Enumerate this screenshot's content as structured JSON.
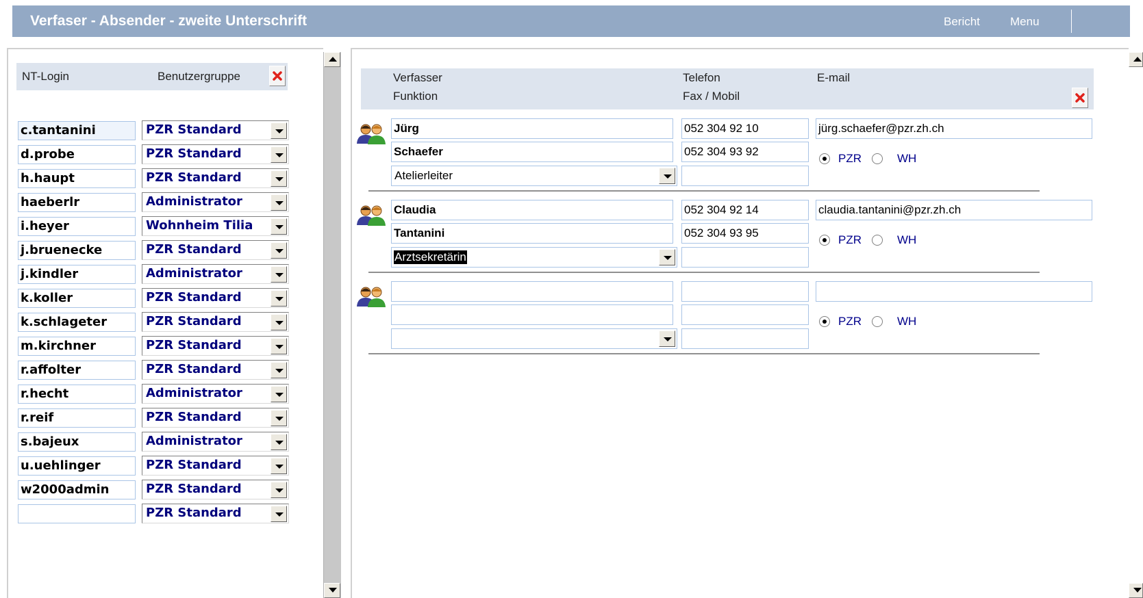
{
  "header": {
    "title": "Verfaser - Absender - zweite Unterschrift",
    "report_label": "Bericht",
    "menu_label": "Menu"
  },
  "users": {
    "columns": {
      "login": "NT-Login",
      "group": "Benutzergruppe"
    },
    "rows": [
      {
        "login": "c.tantanini",
        "group": "PZR Standard"
      },
      {
        "login": "d.probe",
        "group": "PZR Standard"
      },
      {
        "login": "h.haupt",
        "group": "PZR Standard"
      },
      {
        "login": "haeberlr",
        "group": "Administrator"
      },
      {
        "login": "i.heyer",
        "group": "Wohnheim Tilia"
      },
      {
        "login": "j.bruenecke",
        "group": "PZR Standard"
      },
      {
        "login": "j.kindler",
        "group": "Administrator"
      },
      {
        "login": "k.koller",
        "group": "PZR Standard"
      },
      {
        "login": "k.schlageter",
        "group": "PZR Standard"
      },
      {
        "login": "m.kirchner",
        "group": "PZR Standard"
      },
      {
        "login": "r.affolter",
        "group": "PZR Standard"
      },
      {
        "login": "r.hecht",
        "group": "Administrator"
      },
      {
        "login": "r.reif",
        "group": "PZR Standard"
      },
      {
        "login": "s.bajeux",
        "group": "Administrator"
      },
      {
        "login": "u.uehlinger",
        "group": "PZR Standard"
      },
      {
        "login": "w2000admin",
        "group": "PZR Standard"
      },
      {
        "login": "",
        "group": "PZR Standard"
      }
    ]
  },
  "authors": {
    "columns": {
      "author": "Verfasser",
      "function": "Funktion",
      "phone": "Telefon",
      "fax": "Fax / Mobil",
      "email": "E-mail"
    },
    "radio_labels": {
      "pzr": "PZR",
      "wh": "WH"
    },
    "entries": [
      {
        "first_name": "Jürg",
        "last_name": "Schaefer",
        "function": "Atelierleiter",
        "phone": "052 304 92 10",
        "fax": "052 304 93 92",
        "mobile": "",
        "email": "jürg.schaefer@pzr.zh.ch",
        "location": "PZR",
        "function_selected": false
      },
      {
        "first_name": "Claudia",
        "last_name": "Tantanini",
        "function": "Arztsekretärin",
        "phone": "052 304 92 14",
        "fax": "052 304 93 95",
        "mobile": "",
        "email": "claudia.tantanini@pzr.zh.ch",
        "location": "PZR",
        "function_selected": true
      },
      {
        "first_name": "",
        "last_name": "",
        "function": "",
        "phone": "",
        "fax": "",
        "mobile": "",
        "email": "",
        "location": "PZR",
        "function_selected": false
      }
    ]
  },
  "icons": {
    "delete": "delete-x-icon",
    "dropdown": "dropdown-arrow-icon",
    "person": "users-group-icon",
    "scroll_up": "scroll-up-arrow-icon",
    "scroll_down": "scroll-down-arrow-icon"
  },
  "colors": {
    "header_bg": "#93a9c5",
    "table_header_bg": "#dde4ee",
    "group_text": "#00007c",
    "input_border": "#a9c4e6",
    "delete_red": "#e0221b"
  }
}
